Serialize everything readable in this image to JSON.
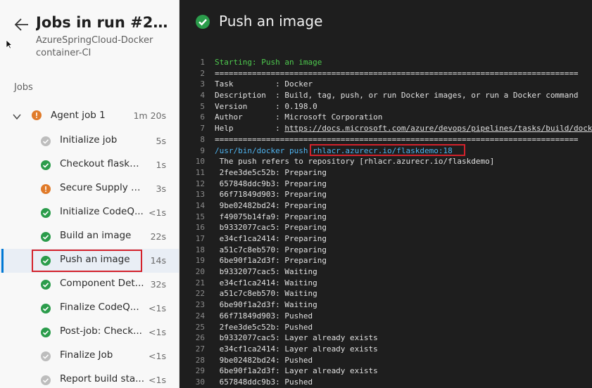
{
  "header": {
    "run_title": "Jobs in run #2022...",
    "pipeline_name": "AzureSpringCloud-Docker container-CI"
  },
  "jobs_label": "Jobs",
  "agent_job": {
    "name": "Agent job 1",
    "duration": "1m 20s",
    "status": "warning"
  },
  "steps": [
    {
      "name": "Initialize job",
      "duration": "5s",
      "status": "skipped"
    },
    {
      "name": "Checkout flaskde...",
      "duration": "1s",
      "status": "succeeded"
    },
    {
      "name": "Secure Supply Ch...",
      "duration": "3s",
      "status": "warning"
    },
    {
      "name": "Initialize CodeQ...",
      "duration": "<1s",
      "status": "succeeded"
    },
    {
      "name": "Build an image",
      "duration": "22s",
      "status": "succeeded"
    },
    {
      "name": "Push an image",
      "duration": "14s",
      "status": "succeeded",
      "selected": true
    },
    {
      "name": "Component Det...",
      "duration": "32s",
      "status": "succeeded"
    },
    {
      "name": "Finalize CodeQ...",
      "duration": "<1s",
      "status": "succeeded"
    },
    {
      "name": "Post-job: Check...",
      "duration": "<1s",
      "status": "succeeded"
    },
    {
      "name": "Finalize Job",
      "duration": "<1s",
      "status": "skipped"
    },
    {
      "name": "Report build sta...",
      "duration": "<1s",
      "status": "skipped"
    }
  ],
  "log_panel": {
    "title": "Push an image",
    "status": "succeeded",
    "lines": [
      {
        "n": "1",
        "text": "Starting: Push an image",
        "style": "green"
      },
      {
        "n": "2",
        "text": "==============================================================================",
        "style": ""
      },
      {
        "n": "3",
        "text": "Task         : Docker",
        "style": ""
      },
      {
        "n": "4",
        "text": "Description  : Build, tag, push, or run Docker images, or run a Docker command",
        "style": ""
      },
      {
        "n": "5",
        "text": "Version      : 0.198.0",
        "style": ""
      },
      {
        "n": "6",
        "text": "Author       : Microsoft Corporation",
        "style": ""
      },
      {
        "n": "7",
        "text": "Help         : ",
        "link": "https://docs.microsoft.com/azure/devops/pipelines/tasks/build/docker",
        "style": ""
      },
      {
        "n": "8",
        "text": "==============================================================================",
        "style": ""
      },
      {
        "n": "9",
        "text": "/usr/bin/docker push rhlacr.azurecr.io/flaskdemo:18",
        "style": "blue",
        "boxed": true
      },
      {
        "n": "10",
        "text": " The push refers to repository [rhlacr.azurecr.io/flaskdemo]",
        "style": ""
      },
      {
        "n": "11",
        "text": " 2fee3de5c52b: Preparing",
        "style": ""
      },
      {
        "n": "12",
        "text": " 657848ddc9b3: Preparing",
        "style": ""
      },
      {
        "n": "13",
        "text": " 66f71849d903: Preparing",
        "style": ""
      },
      {
        "n": "14",
        "text": " 9be02482bd24: Preparing",
        "style": ""
      },
      {
        "n": "15",
        "text": " f49075b14fa9: Preparing",
        "style": ""
      },
      {
        "n": "16",
        "text": " b9332077cac5: Preparing",
        "style": ""
      },
      {
        "n": "17",
        "text": " e34cf1ca2414: Preparing",
        "style": ""
      },
      {
        "n": "18",
        "text": " a51c7c8eb570: Preparing",
        "style": ""
      },
      {
        "n": "19",
        "text": " 6be90f1a2d3f: Preparing",
        "style": ""
      },
      {
        "n": "20",
        "text": " b9332077cac5: Waiting",
        "style": ""
      },
      {
        "n": "21",
        "text": " e34cf1ca2414: Waiting",
        "style": ""
      },
      {
        "n": "22",
        "text": " a51c7c8eb570: Waiting",
        "style": ""
      },
      {
        "n": "23",
        "text": " 6be90f1a2d3f: Waiting",
        "style": ""
      },
      {
        "n": "24",
        "text": " 66f71849d903: Pushed",
        "style": ""
      },
      {
        "n": "25",
        "text": " 2fee3de5c52b: Pushed",
        "style": ""
      },
      {
        "n": "26",
        "text": " b9332077cac5: Layer already exists",
        "style": ""
      },
      {
        "n": "27",
        "text": " e34cf1ca2414: Layer already exists",
        "style": ""
      },
      {
        "n": "28",
        "text": " 9be02482bd24: Pushed",
        "style": ""
      },
      {
        "n": "29",
        "text": " 6be90f1a2d3f: Layer already exists",
        "style": ""
      },
      {
        "n": "30",
        "text": " 657848ddc9b3: Pushed",
        "style": ""
      }
    ]
  },
  "colors": {
    "succeeded": "#2b9c4b",
    "warning": "#e07b2a",
    "skipped": "#bdbdbd",
    "highlight": "#d4222b",
    "accent": "#0078d4"
  }
}
